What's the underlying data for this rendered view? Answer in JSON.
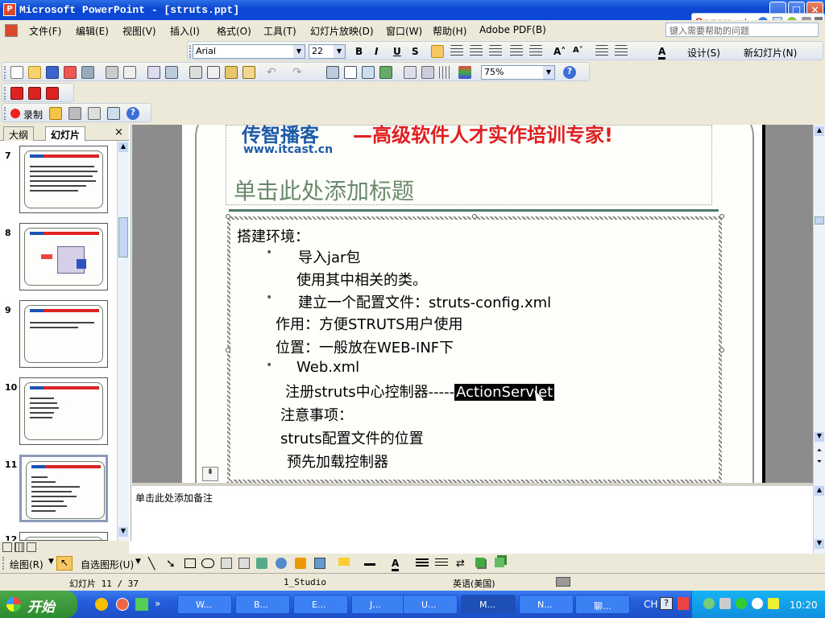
{
  "window": {
    "title": "Microsoft PowerPoint - [struts.ppt]",
    "app_icon": "P"
  },
  "sogou": {
    "logo": "Sogou",
    "mode": "中"
  },
  "menu": {
    "items": [
      "文件(F)",
      "编辑(E)",
      "视图(V)",
      "插入(I)",
      "格式(O)",
      "工具(T)",
      "幻灯片放映(D)",
      "窗口(W)",
      "帮助(H)",
      "Adobe PDF(B)"
    ],
    "help_placeholder": "键入需要帮助的问题"
  },
  "format_toolbar": {
    "font": "Arial",
    "size": "22",
    "design": "设计(S)",
    "new_slide": "新幻灯片(N)"
  },
  "standard_toolbar": {
    "zoom": "75%"
  },
  "record_toolbar": {
    "record": "录制"
  },
  "left_panel": {
    "tabs": [
      "大纲",
      "幻灯片"
    ],
    "close": "×",
    "slides": [
      7,
      8,
      9,
      10,
      11,
      12
    ]
  },
  "slide": {
    "logo_cn": "传智播客",
    "logo_url": "www.itcast.cn",
    "slogan": "—高级软件人才实作培训专家!",
    "title_placeholder": "单击此处添加标题",
    "lines": [
      "搭建环境：",
      "导入jar包",
      "使用其中相关的类。",
      "建立一个配置文件：struts-config.xml",
      "作用：方便STRUTS用户使用",
      "位置：一般放在WEB-INF下",
      "Web.xml",
      "注册struts中心控制器-----",
      "注意事项：",
      "struts配置文件的位置",
      "预先加载控制器"
    ],
    "highlight": "ActionServlet"
  },
  "notes": {
    "placeholder": "单击此处添加备注"
  },
  "draw_toolbar": {
    "draw": "绘图(R)",
    "autoshapes": "自选图形(U)"
  },
  "status": {
    "slide": "幻灯片 11 / 37",
    "design": "1_Studio",
    "language": "英语(美国)"
  },
  "taskbar": {
    "start": "开始",
    "tasks": [
      "W...",
      "B...",
      "E...",
      "J...",
      "U...",
      "M...",
      "N...",
      "聊..."
    ],
    "tray_lang": "CH",
    "clock": "10:20"
  }
}
